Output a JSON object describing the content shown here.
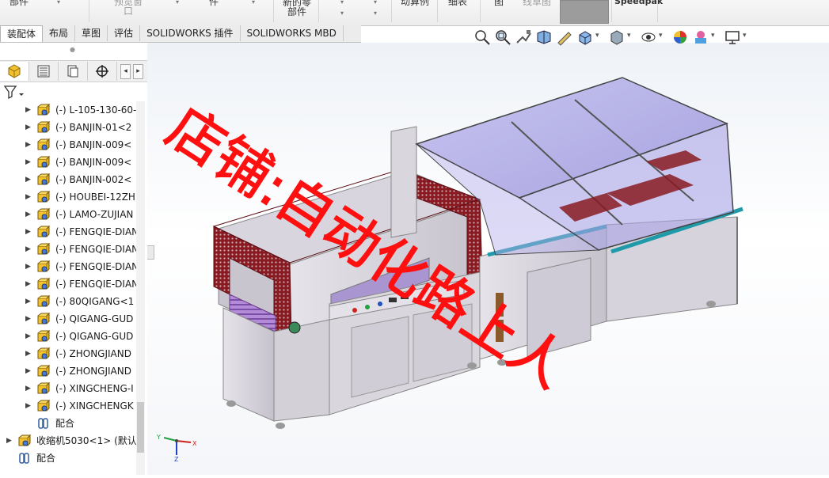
{
  "ribbon": {
    "items": [
      "部件",
      "",
      "预览窗口",
      "",
      "件",
      "",
      "新的零部件",
      "",
      "",
      "动算例",
      "细表",
      "图",
      "线草图",
      "Speedpak"
    ]
  },
  "tabs": [
    {
      "label": "装配体",
      "active": true
    },
    {
      "label": "布局",
      "active": false
    },
    {
      "label": "草图",
      "active": false
    },
    {
      "label": "评估",
      "active": false
    },
    {
      "label": "SOLIDWORKS 插件",
      "active": false
    },
    {
      "label": "SOLIDWORKS MBD",
      "active": false
    }
  ],
  "tree": {
    "items": [
      {
        "label": "(-) L-105-130-60-<",
        "level": 1,
        "caret": true,
        "icon": "part-icon"
      },
      {
        "label": "(-) BANJIN-01<2",
        "level": 1,
        "caret": true,
        "icon": "part-icon"
      },
      {
        "label": "(-) BANJIN-009<",
        "level": 1,
        "caret": true,
        "icon": "part-icon"
      },
      {
        "label": "(-) BANJIN-009<",
        "level": 1,
        "caret": true,
        "icon": "part-icon"
      },
      {
        "label": "(-) BANJIN-002<",
        "level": 1,
        "caret": true,
        "icon": "part-icon"
      },
      {
        "label": "(-) HOUBEI-12ZH",
        "level": 1,
        "caret": true,
        "icon": "part-icon"
      },
      {
        "label": "(-) LAMO-ZUJIAN",
        "level": 1,
        "caret": true,
        "icon": "part-icon"
      },
      {
        "label": "(-) FENGQIE-DIAN",
        "level": 1,
        "caret": true,
        "icon": "part-icon"
      },
      {
        "label": "(-) FENGQIE-DIAN",
        "level": 1,
        "caret": true,
        "icon": "part-icon"
      },
      {
        "label": "(-) FENGQIE-DIAN",
        "level": 1,
        "caret": true,
        "icon": "part-icon"
      },
      {
        "label": "(-) FENGQIE-DIAN",
        "level": 1,
        "caret": true,
        "icon": "part-icon"
      },
      {
        "label": "(-) 80QIGANG<1",
        "level": 1,
        "caret": true,
        "icon": "part-icon"
      },
      {
        "label": "(-) QIGANG-GUD",
        "level": 1,
        "caret": true,
        "icon": "part-icon"
      },
      {
        "label": "(-) QIGANG-GUD",
        "level": 1,
        "caret": true,
        "icon": "part-icon"
      },
      {
        "label": "(-) ZHONGJIAND",
        "level": 1,
        "caret": true,
        "icon": "part-icon"
      },
      {
        "label": "(-) ZHONGJIAND",
        "level": 1,
        "caret": true,
        "icon": "part-icon"
      },
      {
        "label": "(-) XINGCHENG-I",
        "level": 1,
        "caret": true,
        "icon": "part-icon"
      },
      {
        "label": "(-) XINGCHENGK",
        "level": 1,
        "caret": true,
        "icon": "part-icon"
      },
      {
        "label": "配合",
        "level": 1,
        "caret": false,
        "icon": "mates-icon"
      },
      {
        "label": "收缩机5030<1> (默认",
        "level": 0,
        "caret": true,
        "icon": "part-icon"
      },
      {
        "label": "配合",
        "level": 0,
        "caret": false,
        "icon": "mates-icon"
      }
    ]
  },
  "watermark": {
    "text": "店铺:自动化路上人",
    "color": "#ff1010"
  },
  "triad": {
    "x": "X",
    "y": "Y",
    "z": "Z"
  }
}
